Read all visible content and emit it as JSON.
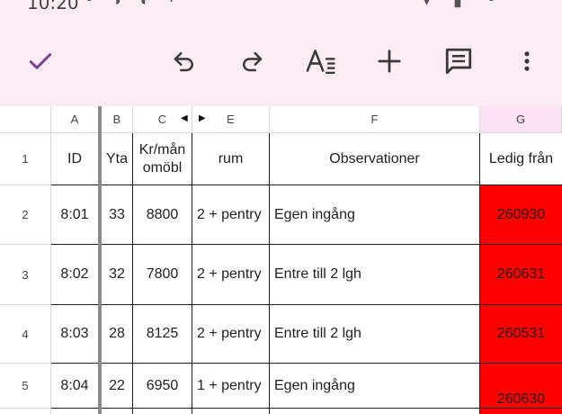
{
  "statusbar": {
    "time": "10:20",
    "left_icons": "◔ ◑ ◐ ·",
    "right_icons": "▾ ▮ ◔"
  },
  "toolbar": {
    "confirm_icon": "check-icon",
    "undo_icon": "undo-icon",
    "redo_icon": "redo-icon",
    "format_icon": "text-format-icon",
    "insert_icon": "plus-icon",
    "comment_icon": "comment-icon",
    "more_icon": "more-vert-icon",
    "accent_color": "#7b3f98"
  },
  "columns": [
    {
      "letter": "A"
    },
    {
      "letter": "B"
    },
    {
      "letter": "C"
    },
    {
      "letter": "E"
    },
    {
      "letter": "F"
    },
    {
      "letter": "G",
      "selected": true
    }
  ],
  "hidden_column_indicators": {
    "left": "◀",
    "right": "▶"
  },
  "header_row": {
    "number": "1",
    "cells": [
      "ID",
      "Yta",
      "Kr/mån omöbl",
      "rum",
      "Observationer",
      "Ledig från"
    ]
  },
  "rows": [
    {
      "number": "2",
      "cells": [
        "8:01",
        "33",
        "8800",
        "2 + pentry",
        "Egen ingång",
        "260930"
      ]
    },
    {
      "number": "3",
      "cells": [
        "8:02",
        "32",
        "7800",
        "2 + pentry",
        "Entre till 2 lgh",
        "260631"
      ]
    },
    {
      "number": "4",
      "cells": [
        "8:03",
        "28",
        "8125",
        "2 + pentry",
        "Entre till 2 lgh",
        "260531"
      ]
    },
    {
      "number": "5",
      "cells": [
        "8:04",
        "22",
        "6950",
        "1 + pentry",
        "Egen ingång",
        "260630"
      ]
    }
  ],
  "highlight_color": "#ff0000"
}
